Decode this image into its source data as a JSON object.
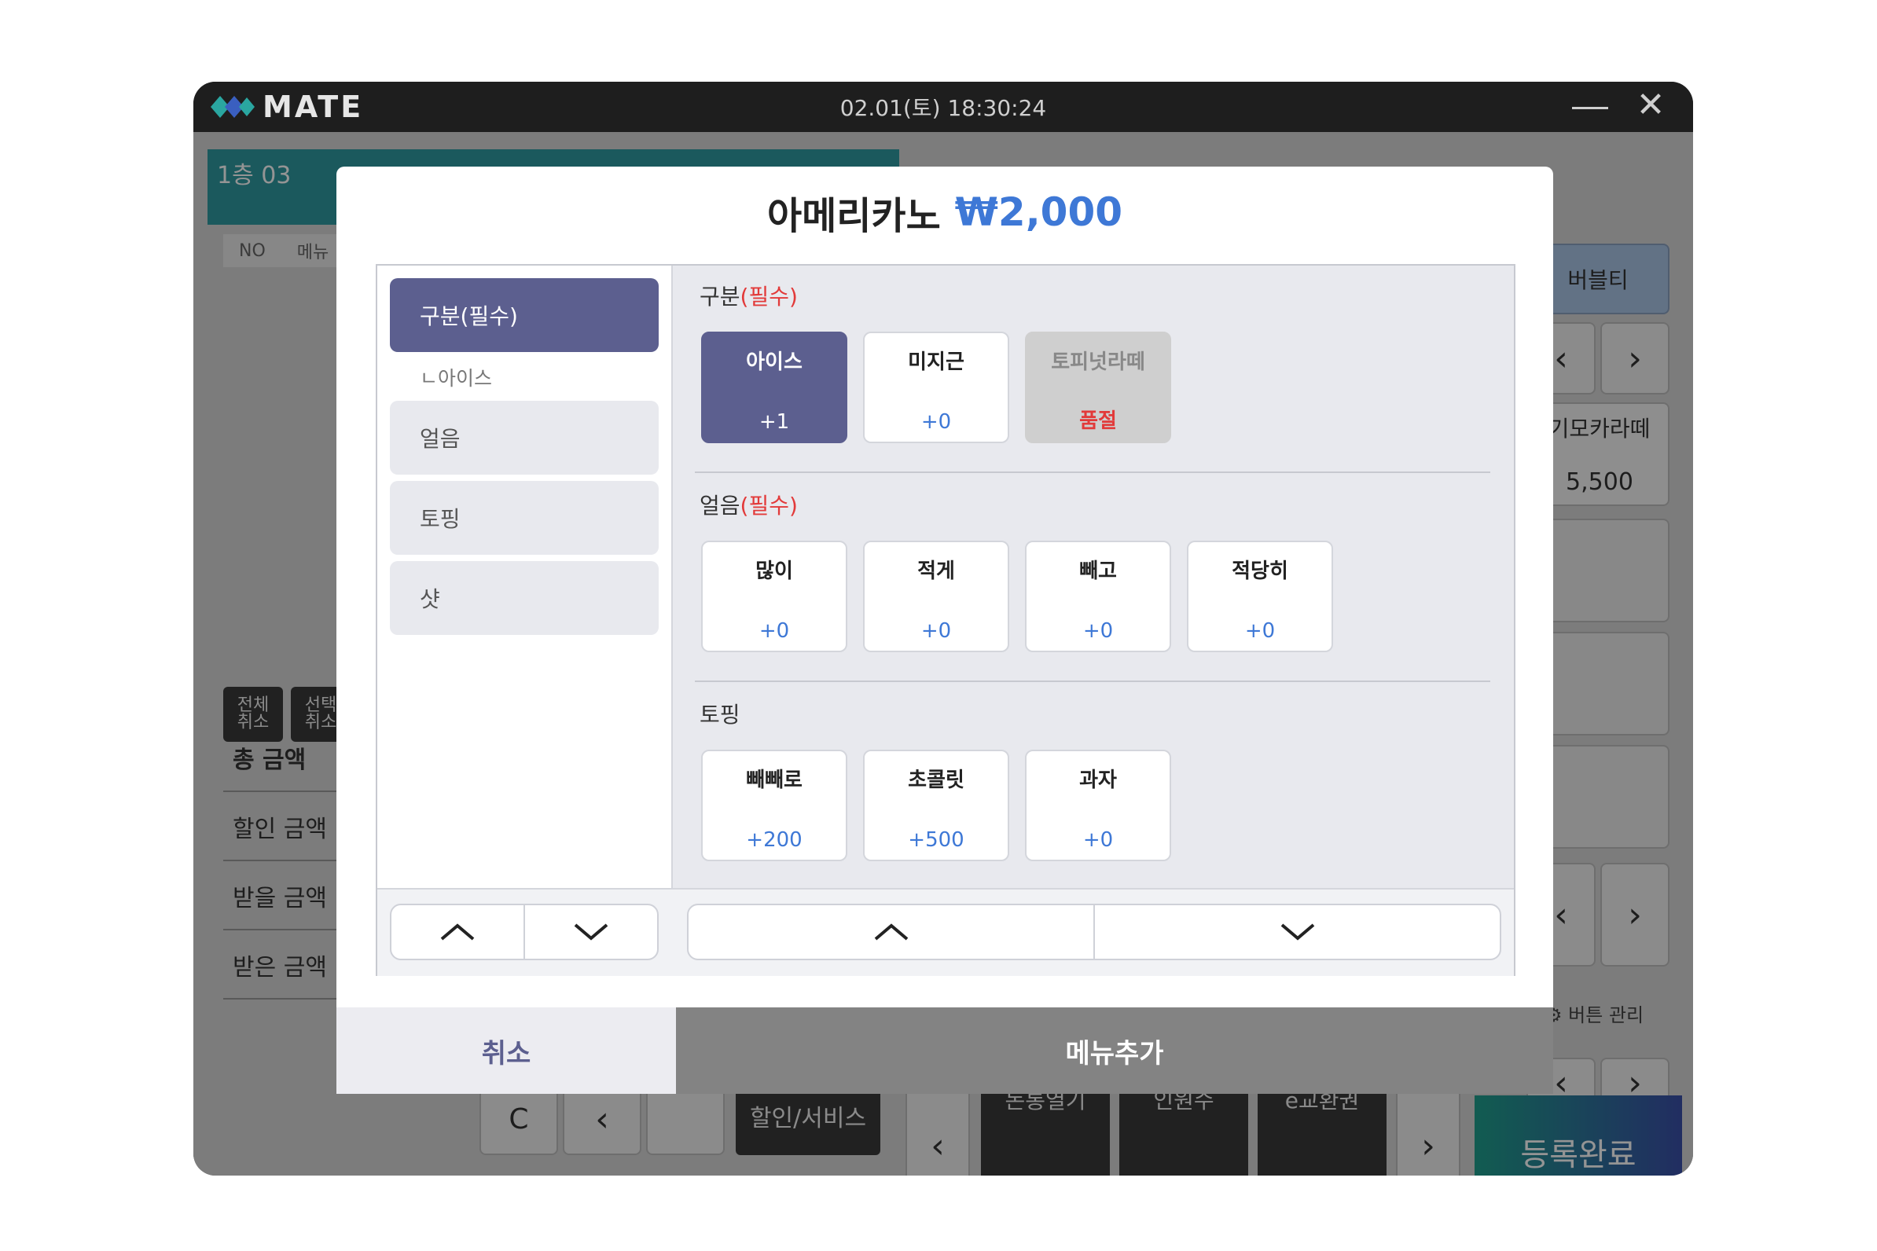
{
  "app": {
    "logo_text": "MATE",
    "clock": "02.01(토) 18:30:24"
  },
  "background": {
    "table_name": "1층 03",
    "columns": [
      "NO",
      "메뉴"
    ],
    "clear_all": "전체 취소",
    "clear_selected": "선택 취소",
    "summary": {
      "total": "총 금액",
      "discount": "할인 금액",
      "receivable": "받을 금액",
      "received": "받은 금액"
    },
    "category_bubbletea": "버블티",
    "item_name": "기모카라떼",
    "item_price": "5,500",
    "manage_buttons": "버튼 관리",
    "keypad_c": "C",
    "discount_service": "할인/서비스",
    "btn_cashdrawer": "돈통열기",
    "btn_voucher": "인원수",
    "btn_exchange": "e교환권",
    "register_done": "등록완료"
  },
  "modal": {
    "menu_name": "아메리카노",
    "menu_price": "₩2,000",
    "categories": [
      {
        "label": "구분(필수)",
        "active": true
      },
      {
        "label": "얼음",
        "active": false
      },
      {
        "label": "토핑",
        "active": false
      },
      {
        "label": "샷",
        "active": false
      }
    ],
    "category_sub": "ㄴ아이스",
    "groups": [
      {
        "label": "구분",
        "required": "(필수)",
        "options": [
          {
            "name": "아이스",
            "price": "+1",
            "state": "selected"
          },
          {
            "name": "미지근",
            "price": "+0",
            "state": "normal"
          },
          {
            "name": "토피넛라떼",
            "price": "품절",
            "state": "soldout"
          }
        ]
      },
      {
        "label": "얼음",
        "required": "(필수)",
        "options": [
          {
            "name": "많이",
            "price": "+0",
            "state": "normal"
          },
          {
            "name": "적게",
            "price": "+0",
            "state": "normal"
          },
          {
            "name": "빼고",
            "price": "+0",
            "state": "normal"
          },
          {
            "name": "적당히",
            "price": "+0",
            "state": "normal"
          }
        ]
      },
      {
        "label": "토핑",
        "required": "",
        "options": [
          {
            "name": "빼빼로",
            "price": "+200",
            "state": "normal"
          },
          {
            "name": "초콜릿",
            "price": "+500",
            "state": "normal"
          },
          {
            "name": "과자",
            "price": "+0",
            "state": "normal"
          }
        ]
      }
    ],
    "cancel_label": "취소",
    "add_label": "메뉴추가"
  },
  "colors": {
    "accent": "#5c5f8f",
    "price_blue": "#3e78d6",
    "required_red": "#e23a3a"
  }
}
